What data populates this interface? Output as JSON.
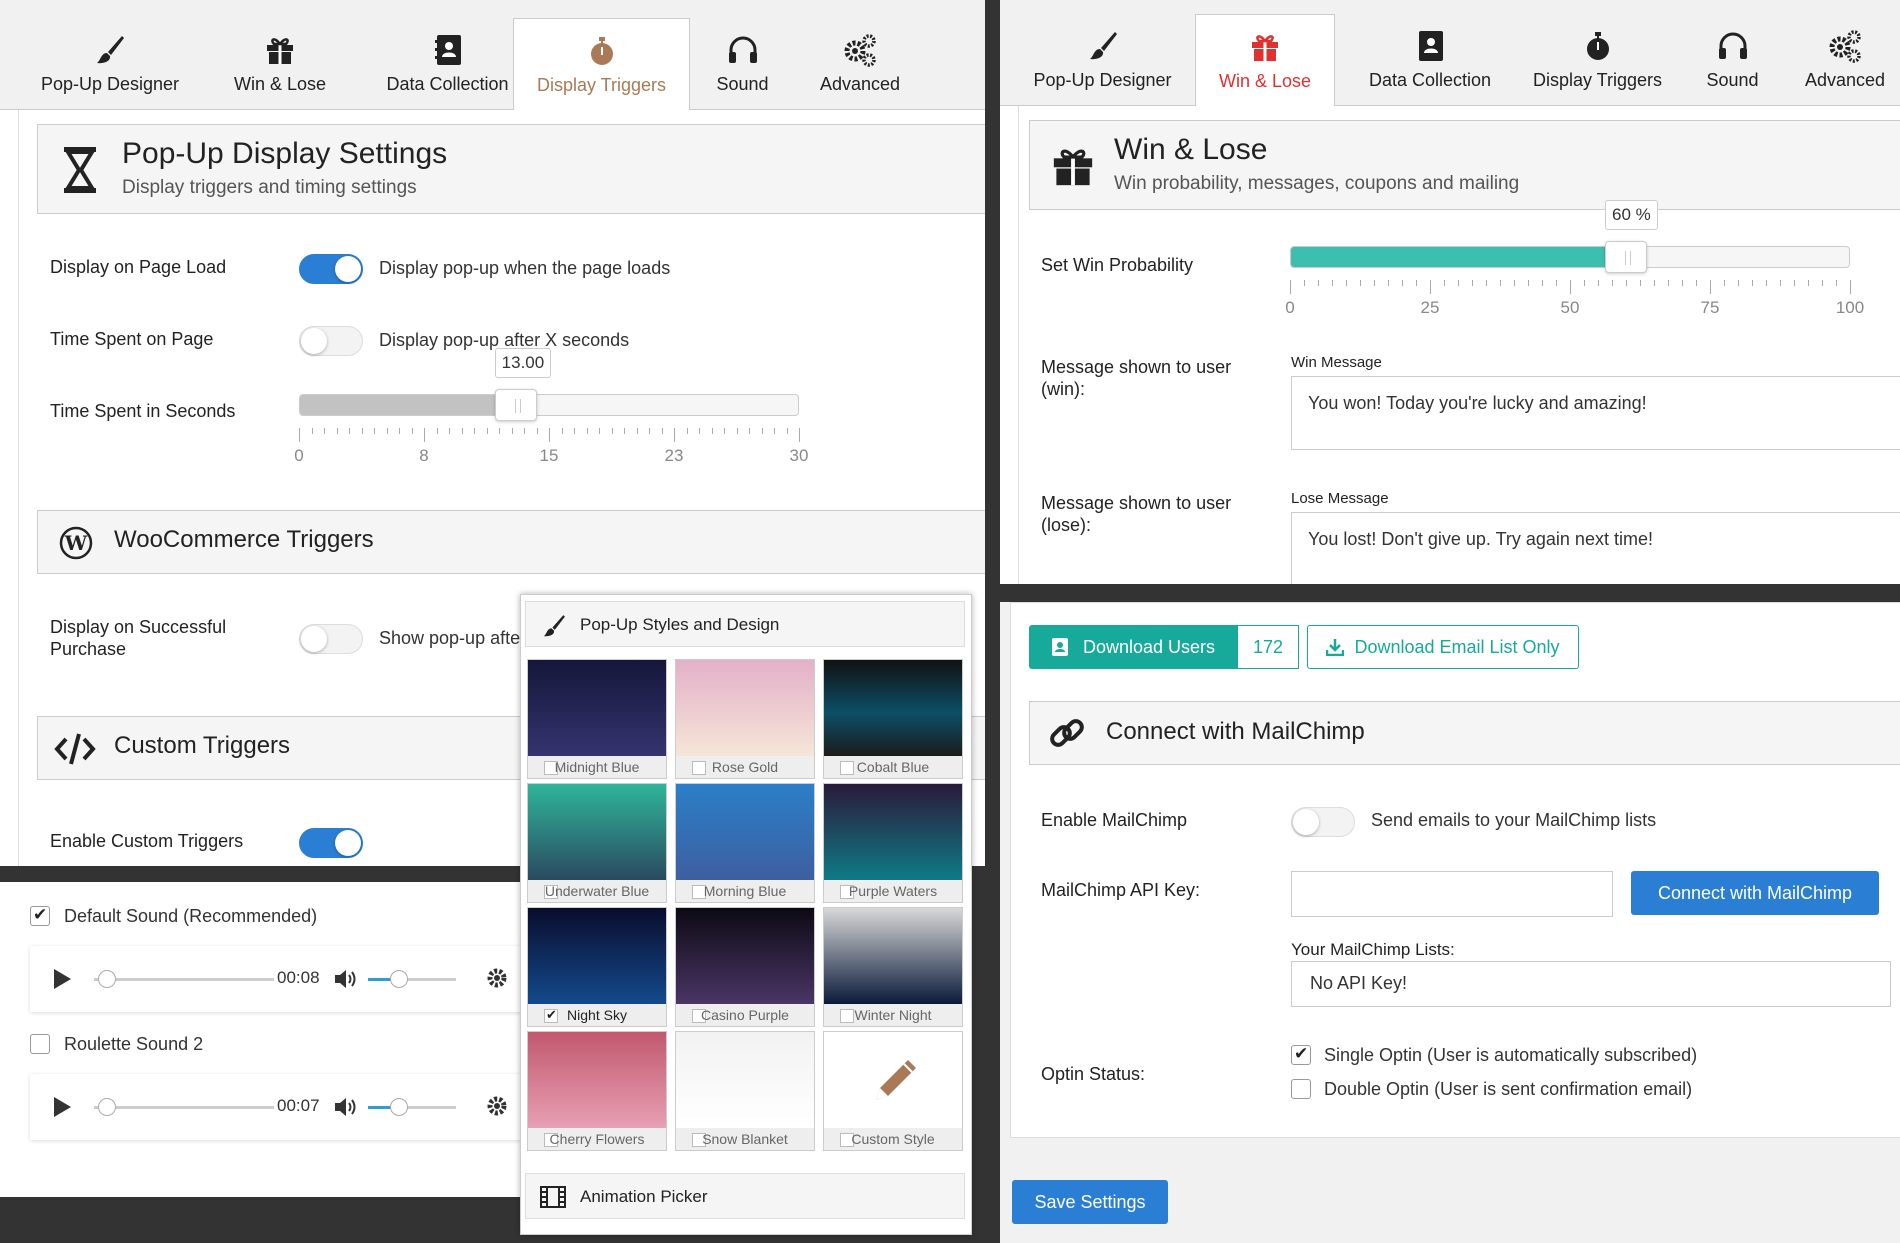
{
  "tabs": [
    "Pop-Up Designer",
    "Win & Lose",
    "Data Collection",
    "Display Triggers",
    "Sound",
    "Advanced"
  ],
  "display": {
    "header_title": "Pop-Up Display Settings",
    "header_sub": "Display triggers and timing settings",
    "rows": {
      "page_load_label": "Display on Page Load",
      "page_load_desc": "Display pop-up when the page loads",
      "page_load_on": true,
      "time_label": "Time Spent on Page",
      "time_desc": "Display pop-up after X seconds",
      "time_on": false,
      "seconds_label": "Time Spent in Seconds",
      "seconds_value_text": "13.00",
      "seconds_value": 13,
      "seconds_min": 0,
      "seconds_max": 30,
      "seconds_ticks": [
        "0",
        "8",
        "15",
        "23",
        "30"
      ]
    },
    "woo_title": "WooCommerce Triggers",
    "purchase_label": "Display on Successful Purchase",
    "purchase_desc": "Show pop-up after",
    "purchase_on": false,
    "custom_title": "Custom Triggers",
    "custom_label": "Enable Custom Triggers",
    "custom_on": true
  },
  "win": {
    "header_title": "Win & Lose",
    "header_sub": "Win probability, messages, coupons and mailing",
    "prob_label": "Set Win Probability",
    "prob_value_text": "60 %",
    "prob_value": 60,
    "prob_ticks": [
      "0",
      "25",
      "50",
      "75",
      "100"
    ],
    "win_msg_label": "Message shown to user (win):",
    "win_field_label": "Win Message",
    "win_message": "You won! Today you're lucky and amazing!",
    "lose_msg_label": "Message shown to user (lose):",
    "lose_field_label": "Lose Message",
    "lose_message": "You lost! Don't give up. Try again next time!"
  },
  "users": {
    "download_users": "Download Users",
    "user_count": "172",
    "download_email": "Download Email List Only",
    "mc_title": "Connect with MailChimp",
    "enable_label": "Enable MailChimp",
    "enable_desc": "Send emails to your MailChimp lists",
    "api_label": "MailChimp API Key:",
    "api_key": "",
    "connect_button": "Connect with MailChimp",
    "lists_label": "Your MailChimp Lists:",
    "lists_value": "No API Key!",
    "optin_label": "Optin Status:",
    "single_optin": "Single Optin (User is automatically subscribed)",
    "double_optin": "Double Optin (User is sent confirmation email)",
    "save_button": "Save Settings"
  },
  "sound": {
    "default_label": "Default Sound (Recommended)",
    "default_time": "00:08",
    "roulette_label": "Roulette Sound 2",
    "roulette_time": "00:07"
  },
  "styles": {
    "title": "Pop-Up Styles and Design",
    "items": [
      {
        "name": "Midnight Blue",
        "checked": false
      },
      {
        "name": "Rose Gold",
        "checked": false
      },
      {
        "name": "Cobalt Blue",
        "checked": false
      },
      {
        "name": "Underwater Blue",
        "checked": false
      },
      {
        "name": "Morning Blue",
        "checked": false
      },
      {
        "name": "Purple Waters",
        "checked": false
      },
      {
        "name": "Night Sky",
        "checked": true
      },
      {
        "name": "Casino Purple",
        "checked": false
      },
      {
        "name": "Winter Night",
        "checked": false
      },
      {
        "name": "Cherry Flowers",
        "checked": false
      },
      {
        "name": "Snow Blanket",
        "checked": false
      },
      {
        "name": "Custom Style",
        "checked": false
      }
    ],
    "animation_title": "Animation Picker"
  },
  "colors": {
    "accent_blue": "#2a7fd4",
    "teal": "#3dbfb0",
    "tab_active": "#a97a55",
    "swatch_button_teal": "#17a99a"
  }
}
